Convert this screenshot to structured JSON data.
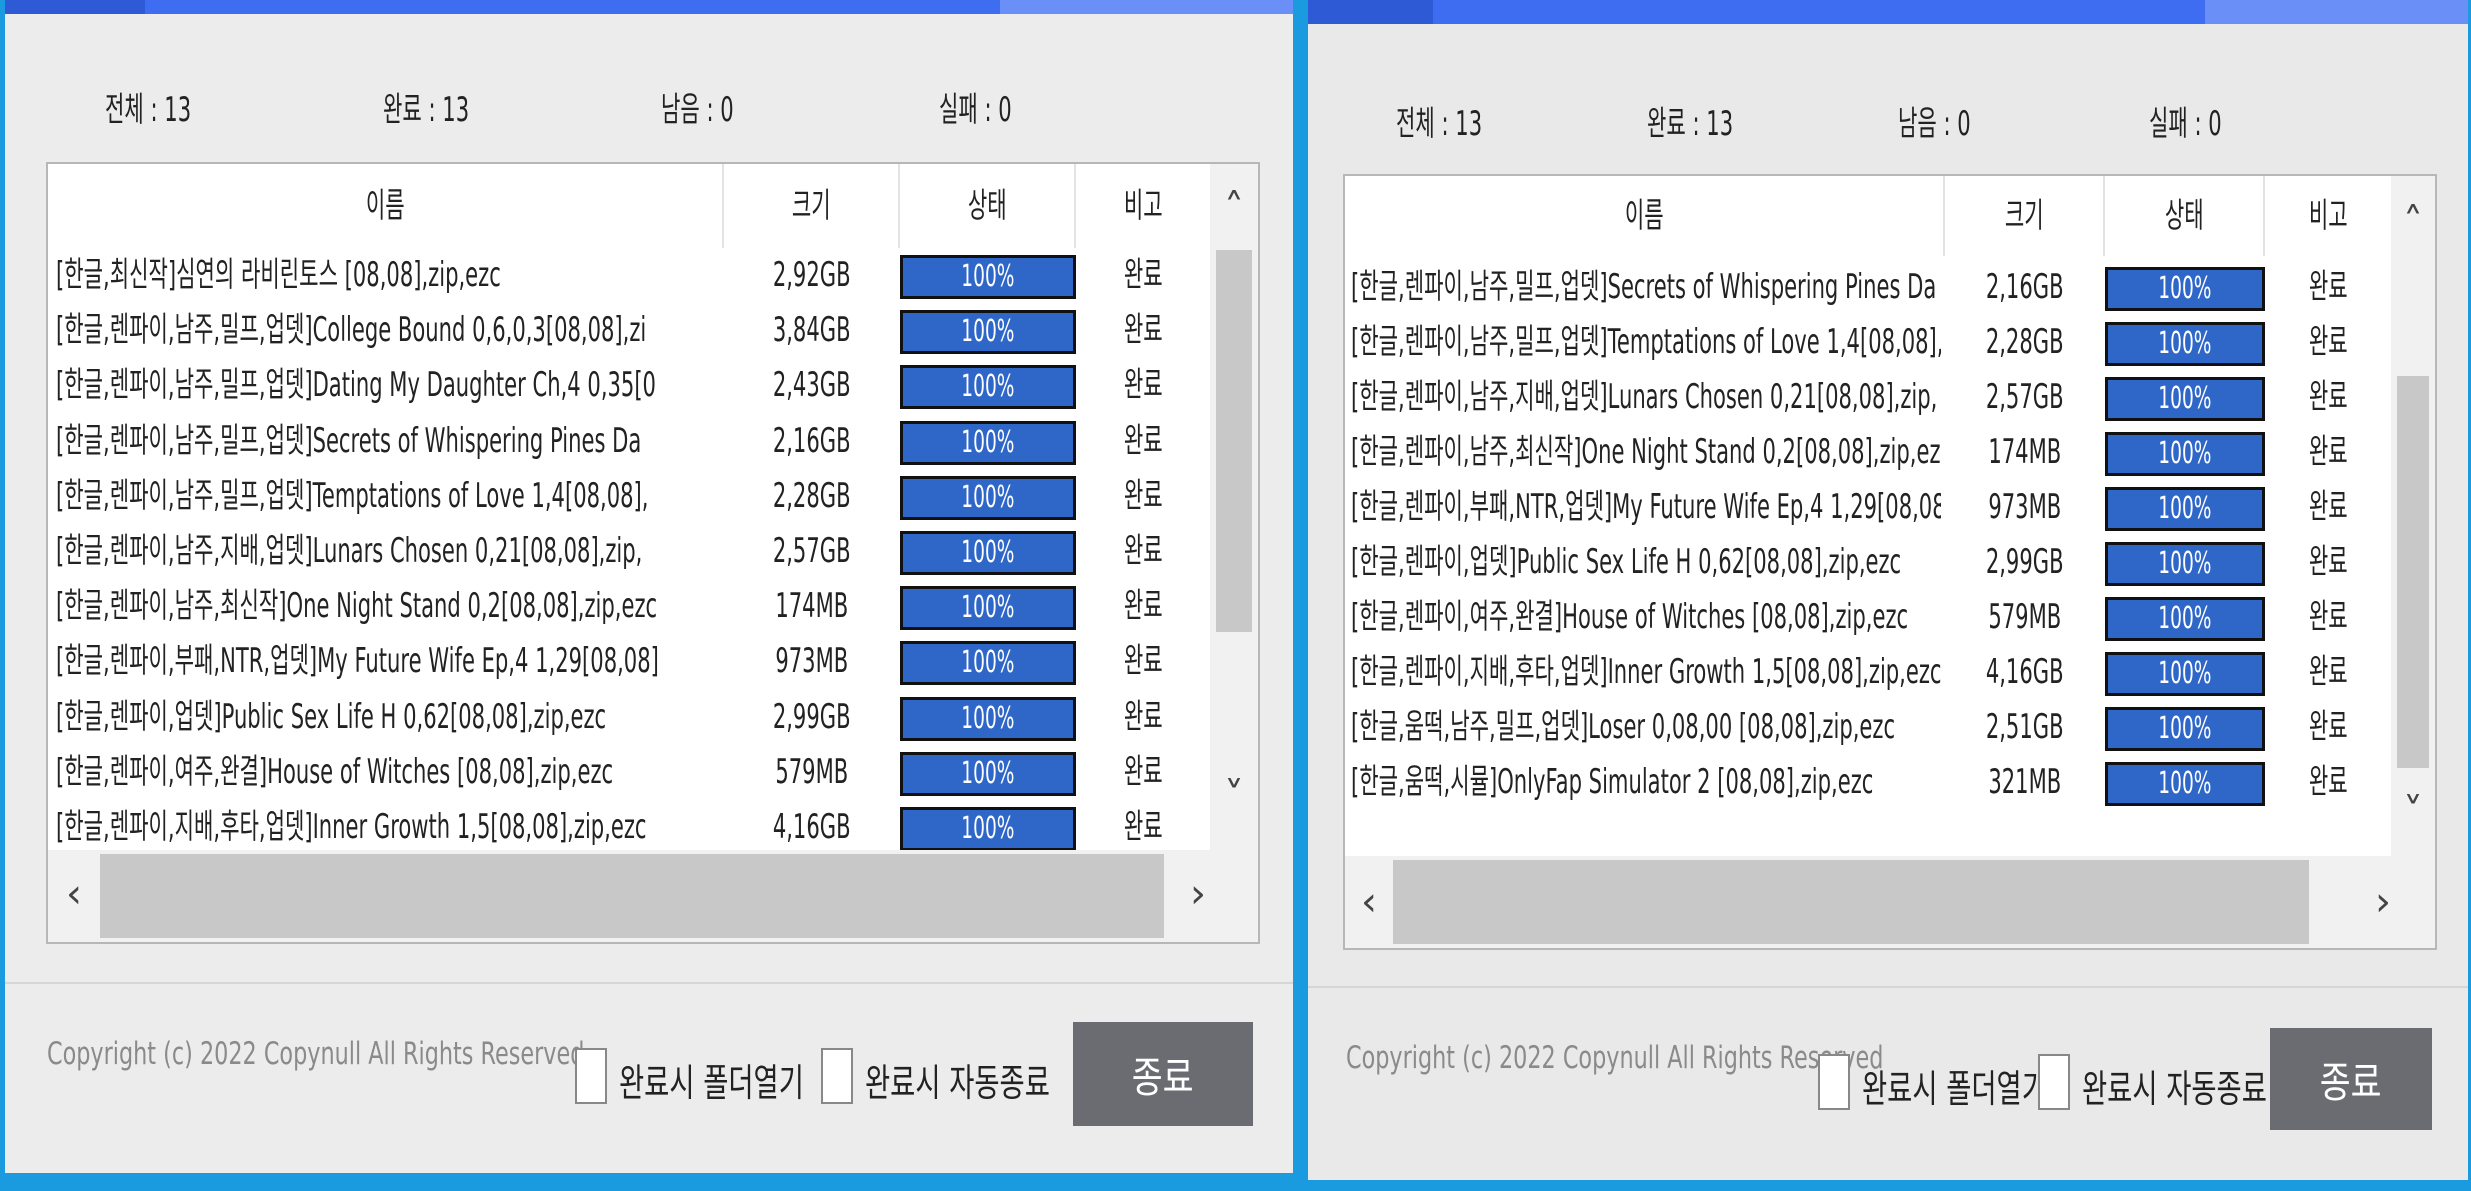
{
  "windows": [
    {
      "stats": {
        "total": "전체 : 13",
        "done": "완료 : 13",
        "remaining": "남음 : 0",
        "failed": "실패 : 0"
      },
      "columns": [
        "이름",
        "크기",
        "상태",
        "비고"
      ],
      "rows": [
        {
          "name": "[한글,최신작]심연의 라비린토스 [08,08],zip,ezc",
          "size": "2,92GB",
          "status": "100%",
          "note": "완료",
          "progress": 100
        },
        {
          "name": "[한글,렌파이,남주,밀프,업뎃]College Bound 0,6,0,3[08,08],zi",
          "size": "3,84GB",
          "status": "100%",
          "note": "완료",
          "progress": 100
        },
        {
          "name": "[한글,렌파이,남주,밀프,업뎃]Dating My Daughter Ch,4 0,35[0",
          "size": "2,43GB",
          "status": "100%",
          "note": "완료",
          "progress": 100
        },
        {
          "name": "[한글,렌파이,남주,밀프,업뎃]Secrets of Whispering Pines Da",
          "size": "2,16GB",
          "status": "100%",
          "note": "완료",
          "progress": 100
        },
        {
          "name": "[한글,렌파이,남주,밀프,업뎃]Temptations of Love 1,4[08,08],",
          "size": "2,28GB",
          "status": "100%",
          "note": "완료",
          "progress": 100
        },
        {
          "name": "[한글,렌파이,남주,지배,업뎃]Lunars Chosen 0,21[08,08],zip,",
          "size": "2,57GB",
          "status": "100%",
          "note": "완료",
          "progress": 100
        },
        {
          "name": "[한글,렌파이,남주,최신작]One Night Stand 0,2[08,08],zip,ezc",
          "size": "174MB",
          "status": "100%",
          "note": "완료",
          "progress": 100
        },
        {
          "name": "[한글,렌파이,부패,NTR,업뎃]My Future Wife Ep,4 1,29[08,08]",
          "size": "973MB",
          "status": "100%",
          "note": "완료",
          "progress": 100
        },
        {
          "name": "[한글,렌파이,업뎃]Public Sex Life H 0,62[08,08],zip,ezc",
          "size": "2,99GB",
          "status": "100%",
          "note": "완료",
          "progress": 100
        },
        {
          "name": "[한글,렌파이,여주,완결]House of Witches [08,08],zip,ezc",
          "size": "579MB",
          "status": "100%",
          "note": "완료",
          "progress": 100
        },
        {
          "name": "[한글,렌파이,지배,후타,업뎃]Inner Growth 1,5[08,08],zip,ezc",
          "size": "4,16GB",
          "status": "100%",
          "note": "완료",
          "progress": 100
        }
      ],
      "copyright": "Copyright (c) 2022 Copynull All Rights Reserved",
      "checkbox_open_folder": "완료시 폴더열기",
      "checkbox_auto_exit": "완료시 자동종료",
      "close_button": "종료",
      "scroll_up": "˄",
      "scroll_down": "˅",
      "scroll_left": "‹",
      "scroll_right": "›"
    },
    {
      "stats": {
        "total": "전체 : 13",
        "done": "완료 : 13",
        "remaining": "남음 : 0",
        "failed": "실패 : 0"
      },
      "columns": [
        "이름",
        "크기",
        "상태",
        "비고"
      ],
      "rows": [
        {
          "name": "[한글,렌파이,남주,밀프,업뎃]Secrets of Whispering Pines Da",
          "size": "2,16GB",
          "status": "100%",
          "note": "완료",
          "progress": 100
        },
        {
          "name": "[한글,렌파이,남주,밀프,업뎃]Temptations of Love 1,4[08,08],",
          "size": "2,28GB",
          "status": "100%",
          "note": "완료",
          "progress": 100
        },
        {
          "name": "[한글,렌파이,남주,지배,업뎃]Lunars Chosen 0,21[08,08],zip,",
          "size": "2,57GB",
          "status": "100%",
          "note": "완료",
          "progress": 100
        },
        {
          "name": "[한글,렌파이,남주,최신작]One Night Stand 0,2[08,08],zip,ezc",
          "size": "174MB",
          "status": "100%",
          "note": "완료",
          "progress": 100
        },
        {
          "name": "[한글,렌파이,부패,NTR,업뎃]My Future Wife Ep,4 1,29[08,08]",
          "size": "973MB",
          "status": "100%",
          "note": "완료",
          "progress": 100
        },
        {
          "name": "[한글,렌파이,업뎃]Public Sex Life H 0,62[08,08],zip,ezc",
          "size": "2,99GB",
          "status": "100%",
          "note": "완료",
          "progress": 100
        },
        {
          "name": "[한글,렌파이,여주,완결]House of Witches [08,08],zip,ezc",
          "size": "579MB",
          "status": "100%",
          "note": "완료",
          "progress": 100
        },
        {
          "name": "[한글,렌파이,지배,후타,업뎃]Inner Growth 1,5[08,08],zip,ezc",
          "size": "4,16GB",
          "status": "100%",
          "note": "완료",
          "progress": 100
        },
        {
          "name": "[한글,움떡,남주,밀프,업뎃]Loser 0,08,00 [08,08],zip,ezc",
          "size": "2,51GB",
          "status": "100%",
          "note": "완료",
          "progress": 100
        },
        {
          "name": "[한글,움떡,시뮬]OnlyFap Simulator 2 [08,08],zip,ezc",
          "size": "321MB",
          "status": "100%",
          "note": "완료",
          "progress": 100
        }
      ],
      "copyright": "Copyright (c) 2022 Copynull All Rights Reserved",
      "checkbox_open_folder": "완료시 폴더열기",
      "checkbox_auto_exit": "완료시 자동종료",
      "close_button": "종료",
      "scroll_up": "˄",
      "scroll_down": "˅",
      "scroll_left": "‹",
      "scroll_right": "›"
    }
  ],
  "colors": {
    "progress_fill": "#2f67c9",
    "title_bar": "#3f6df2",
    "background": "#1a9be0",
    "close_button": "#6b6b72"
  }
}
